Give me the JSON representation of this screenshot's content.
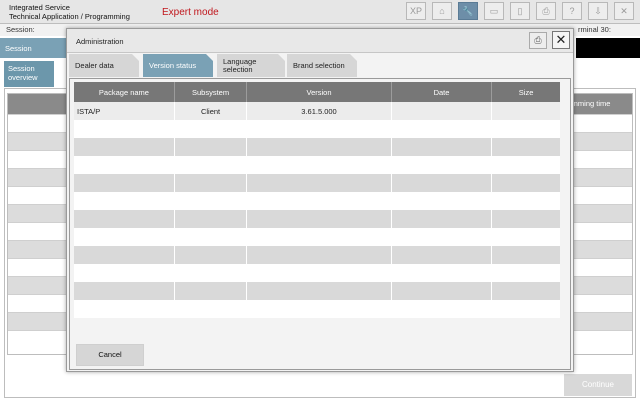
{
  "app": {
    "title_line1": "Integrated Service",
    "title_line2": "Technical Application / Programming",
    "mode": "Expert mode",
    "toolbar": [
      {
        "name": "xp-icon",
        "glyph": "XP",
        "active": false
      },
      {
        "name": "home-icon",
        "glyph": "⌂",
        "active": false
      },
      {
        "name": "wrench-icon",
        "glyph": "🔧",
        "active": true
      },
      {
        "name": "vehicle-info-icon",
        "glyph": "▭",
        "active": false
      },
      {
        "name": "battery-icon",
        "glyph": "▯",
        "active": false
      },
      {
        "name": "print-icon",
        "glyph": "⎙",
        "active": false
      },
      {
        "name": "help-icon",
        "glyph": "?",
        "active": false
      },
      {
        "name": "download-icon",
        "glyph": "⇩",
        "active": false
      },
      {
        "name": "close-icon",
        "glyph": "✕",
        "active": false
      }
    ]
  },
  "status": {
    "session": "Session:",
    "terminal": "rminal 30:"
  },
  "background": {
    "session_tab": "Session",
    "overview_tab_line1": "Session",
    "overview_tab_line2": "overview",
    "column_label": "ramming time",
    "continue_label": "Continue"
  },
  "dialog": {
    "title": "Administration",
    "tabs": [
      {
        "label": "Dealer data",
        "active": false
      },
      {
        "label": "Version status",
        "active": true
      },
      {
        "label": "Language selection",
        "active": false
      },
      {
        "label": "Brand selection",
        "active": false
      }
    ],
    "table": {
      "headers": [
        "Package name",
        "Subsystem",
        "Version",
        "Date",
        "Size"
      ],
      "rows": [
        [
          "ISTA/P",
          "Client",
          "3.61.5.000",
          "",
          ""
        ]
      ],
      "total_rows": 12
    },
    "cancel_label": "Cancel"
  }
}
